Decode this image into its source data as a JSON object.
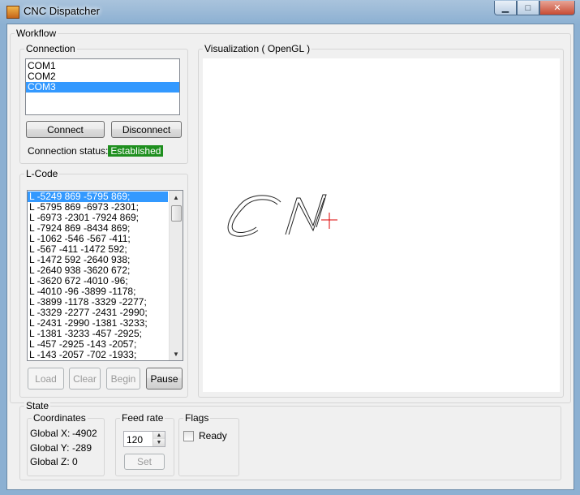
{
  "window": {
    "title": "CNC Dispatcher",
    "minimize_glyph": "▁",
    "maximize_glyph": "□",
    "close_glyph": "✕"
  },
  "workflow": {
    "label": "Workflow",
    "connection": {
      "label": "Connection",
      "ports": [
        "COM1",
        "COM2",
        "COM3"
      ],
      "selected_port": "COM3",
      "connect_label": "Connect",
      "disconnect_label": "Disconnect",
      "status_label": "Connection status:",
      "status_value": "Established",
      "status_color": "#1f8f1f"
    },
    "lcode": {
      "label": "L-Code",
      "lines": [
        "L -5249 869 -5795 869;",
        "L -5795 869 -6973 -2301;",
        "L -6973 -2301 -7924 869;",
        "L -7924 869 -8434 869;",
        "L -1062 -546 -567 -411;",
        "L -567 -411 -1472 592;",
        "L -1472 592 -2640 938;",
        "L -2640 938 -3620 672;",
        "L -3620 672 -4010 -96;",
        "L -4010 -96 -3899 -1178;",
        "L -3899 -1178 -3329 -2277;",
        "L -3329 -2277 -2431 -2990;",
        "L -2431 -2990 -1381 -3233;",
        "L -1381 -3233 -457 -2925;",
        "L -457 -2925 -143 -2057;",
        "L -143 -2057 -702 -1933;"
      ],
      "selected_index": 0,
      "load_label": "Load",
      "clear_label": "Clear",
      "begin_label": "Begin",
      "pause_label": "Pause"
    },
    "visualization": {
      "label": "Visualization ( OpenGL )",
      "cursor_color": "#dd0000"
    }
  },
  "state": {
    "label": "State",
    "coordinates": {
      "label": "Coordinates",
      "x_label": "Global X:",
      "x_value": "-4902",
      "y_label": "Global Y:",
      "y_value": "-289",
      "z_label": "Global Z:",
      "z_value": "0"
    },
    "feed_rate": {
      "label": "Feed rate",
      "value": "120",
      "set_label": "Set"
    },
    "flags": {
      "label": "Flags",
      "ready_label": "Ready",
      "ready_checked": false
    }
  }
}
